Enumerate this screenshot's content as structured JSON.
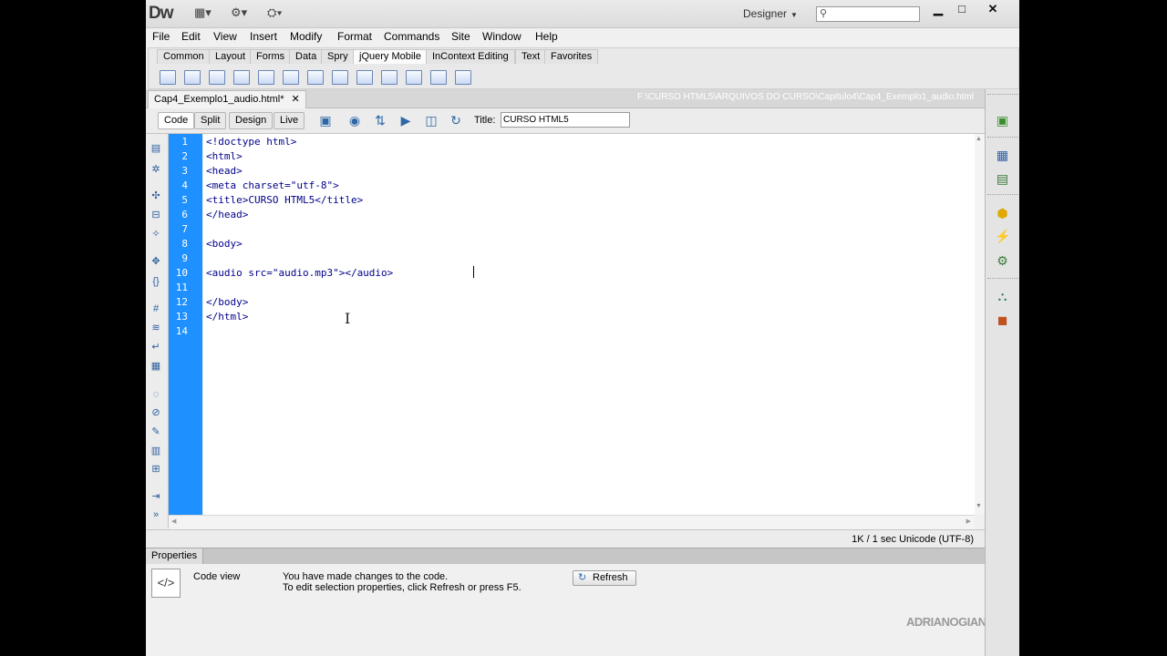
{
  "app": {
    "logo": "Dw",
    "workspace": "Designer",
    "search_placeholder": "",
    "window_controls": [
      "minimize-icon",
      "maximize-icon",
      "close-icon"
    ]
  },
  "menu": [
    "File",
    "Edit",
    "View",
    "Insert",
    "Modify",
    "Format",
    "Commands",
    "Site",
    "Window",
    "Help"
  ],
  "insert_tabs": [
    "Common",
    "Layout",
    "Forms",
    "Data",
    "Spry",
    "jQuery Mobile",
    "InContext Editing",
    "Text",
    "Favorites"
  ],
  "insert_active_tab": "jQuery Mobile",
  "document": {
    "tab_name": "Cap4_Exemplo1_audio.html*",
    "path": "F:\\CURSO HTML5\\ARQUIVOS DO CURSO\\Capitulo4\\Cap4_Exemplo1_audio.html",
    "view_buttons": [
      "Code",
      "Split",
      "Design",
      "Live"
    ],
    "active_view": "Code",
    "title_label": "Title:",
    "title_value": "CURSO HTML5"
  },
  "code": {
    "lines": [
      "<!doctype html>",
      "<html>",
      "<head>",
      "<meta charset=\"utf-8\">",
      "<title>CURSO HTML5</title>",
      "</head>",
      "",
      "<body>",
      "",
      "<audio src=\"audio.mp3\"></audio>",
      "",
      "</body>",
      "</html>",
      ""
    ],
    "line_numbers": [
      "1",
      "2",
      "3",
      "4",
      "5",
      "6",
      "7",
      "8",
      "9",
      "10",
      "11",
      "12",
      "13",
      "14"
    ]
  },
  "status": {
    "text": "1K / 1 sec  Unicode (UTF-8)"
  },
  "properties": {
    "header": "Properties",
    "label": "Code view",
    "message_line1": "You have made changes to the code.",
    "message_line2": "To edit selection properties, click Refresh or press F5.",
    "refresh_label": "Refresh"
  },
  "watermark": "ADRIANOGIANINI"
}
